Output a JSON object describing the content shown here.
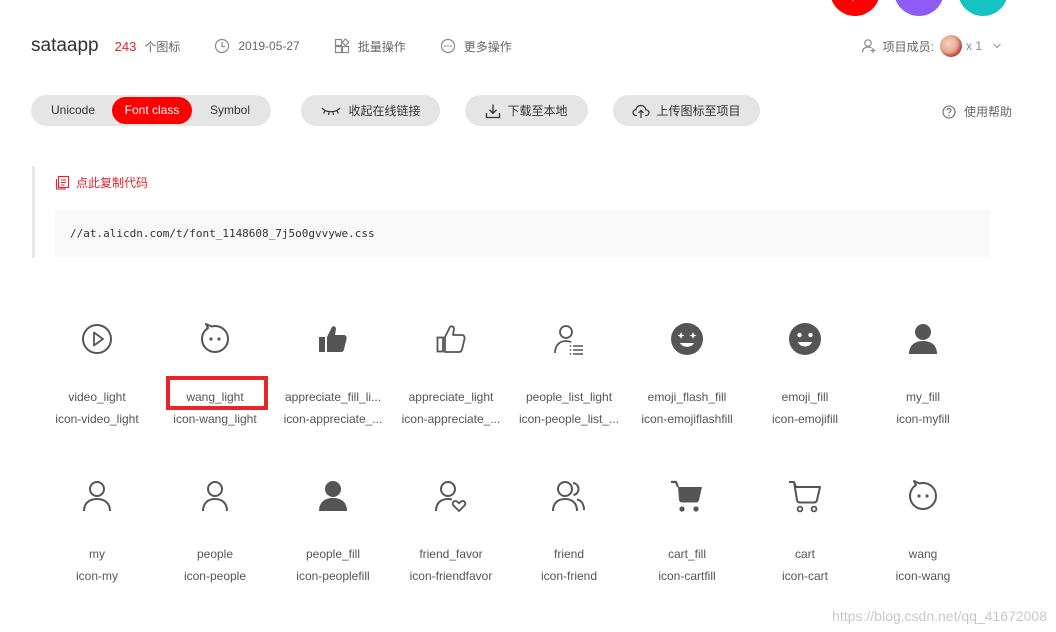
{
  "header": {
    "project_name": "sataapp",
    "icon_count": "243",
    "icon_count_label": "个图标",
    "date": "2019-05-27",
    "batch_label": "批量操作",
    "more_label": "更多操作",
    "members_label": "项目成员:",
    "member_count": "x 1"
  },
  "toolbar": {
    "segments": [
      "Unicode",
      "Font class",
      "Symbol"
    ],
    "selected_segment": "Font class",
    "collapse_link_label": "收起在线链接",
    "download_label": "下载至本地",
    "upload_label": "上传图标至项目",
    "help_label": "使用帮助"
  },
  "code": {
    "copy_label": "点此复制代码",
    "url": "//at.alicdn.com/t/font_1148608_7j5o0gvvywe.css"
  },
  "icons": [
    [
      {
        "name": "video_light",
        "class": "icon-video_light",
        "icon": "play-circle-icon"
      },
      {
        "name": "wang_light",
        "class": "icon-wang_light",
        "icon": "wang-face-icon"
      },
      {
        "name": "appreciate_fill_li...",
        "class": "icon-appreciate_...",
        "icon": "thumb-up-fill-icon"
      },
      {
        "name": "appreciate_light",
        "class": "icon-appreciate_...",
        "icon": "thumb-up-outline-icon"
      },
      {
        "name": "people_list_light",
        "class": "icon-people_list_...",
        "icon": "people-list-icon"
      },
      {
        "name": "emoji_flash_fill",
        "class": "icon-emojiflashfill",
        "icon": "emoji-flash-icon"
      },
      {
        "name": "emoji_fill",
        "class": "icon-emojifill",
        "icon": "emoji-fill-icon"
      },
      {
        "name": "my_fill",
        "class": "icon-myfill",
        "icon": "person-fill-icon"
      }
    ],
    [
      {
        "name": "my",
        "class": "icon-my",
        "icon": "person-outline-icon"
      },
      {
        "name": "people",
        "class": "icon-people",
        "icon": "people-outline-icon"
      },
      {
        "name": "people_fill",
        "class": "icon-peoplefill",
        "icon": "people-fill-icon"
      },
      {
        "name": "friend_favor",
        "class": "icon-friendfavor",
        "icon": "friend-favor-icon"
      },
      {
        "name": "friend",
        "class": "icon-friend",
        "icon": "friend-icon"
      },
      {
        "name": "cart_fill",
        "class": "icon-cartfill",
        "icon": "cart-fill-icon"
      },
      {
        "name": "cart",
        "class": "icon-cart",
        "icon": "cart-outline-icon"
      },
      {
        "name": "wang",
        "class": "icon-wang",
        "icon": "wang-icon"
      }
    ]
  ],
  "watermark": "https://blog.csdn.net/qq_41672008",
  "colors": {
    "accent": "#ff0000",
    "icon": "#555555",
    "highlight": "#e8262a"
  }
}
